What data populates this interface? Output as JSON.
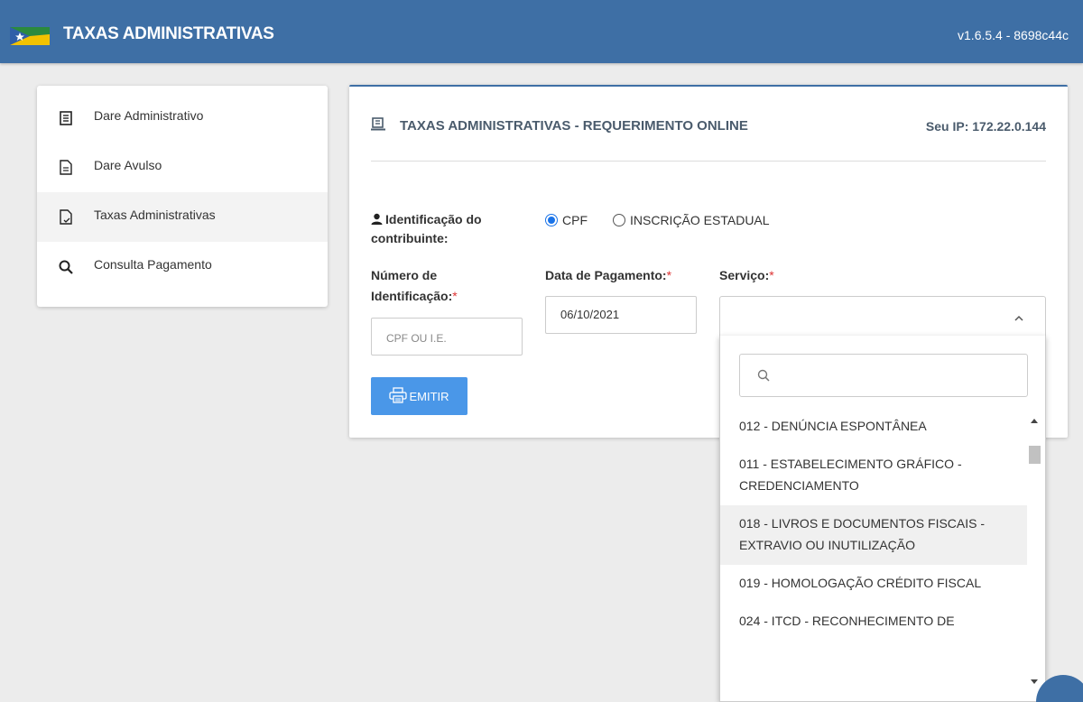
{
  "header": {
    "title": "TAXAS ADMINISTRATIVAS",
    "version": "v1.6.5.4 - 8698c44c",
    "bg_color": "#3e6fa5"
  },
  "sidebar": {
    "items": [
      {
        "label": "Dare Administrativo",
        "icon": "list-document-icon",
        "active": false
      },
      {
        "label": "Dare Avulso",
        "icon": "document-icon",
        "active": false
      },
      {
        "label": "Taxas Administrativas",
        "icon": "document-check-icon",
        "active": true
      },
      {
        "label": "Consulta Pagamento",
        "icon": "search-icon",
        "active": false
      }
    ]
  },
  "panel": {
    "title": "TAXAS ADMINISTRATIVAS - REQUERIMENTO ONLINE",
    "ip_label": "Seu IP: 172.22.0.144",
    "identification_label": "Identificação do contribuinte:",
    "radio_options": [
      {
        "label": "CPF",
        "checked": true
      },
      {
        "label": "INSCRIÇÃO ESTADUAL",
        "checked": false
      }
    ],
    "numero_label": "Número de Identificação:",
    "numero_placeholder": "CPF OU I.E.",
    "data_label": "Data de Pagamento:",
    "data_value": "06/10/2021",
    "servico_label": "Serviço:",
    "required_mark": "*",
    "emitir_label": "EMITIR"
  },
  "dropdown": {
    "search_value": "",
    "items": [
      {
        "label": "012 - DENÚNCIA ESPONTÂNEA",
        "highlighted": false
      },
      {
        "label": "011 - ESTABELECIMENTO GRÁFICO - CREDENCIAMENTO",
        "highlighted": false
      },
      {
        "label": "018 - LIVROS E DOCUMENTOS FISCAIS - EXTRAVIO OU INUTILIZAÇÃO",
        "highlighted": true
      },
      {
        "label": "019 - HOMOLOGAÇÃO CRÉDITO FISCAL",
        "highlighted": false
      },
      {
        "label": "024 - ITCD - RECONHECIMENTO DE",
        "highlighted": false
      }
    ]
  },
  "colors": {
    "accent": "#3e6fa5",
    "button": "#4a97e8",
    "required": "#dd3333",
    "radio_checked": "#1a73e8"
  }
}
